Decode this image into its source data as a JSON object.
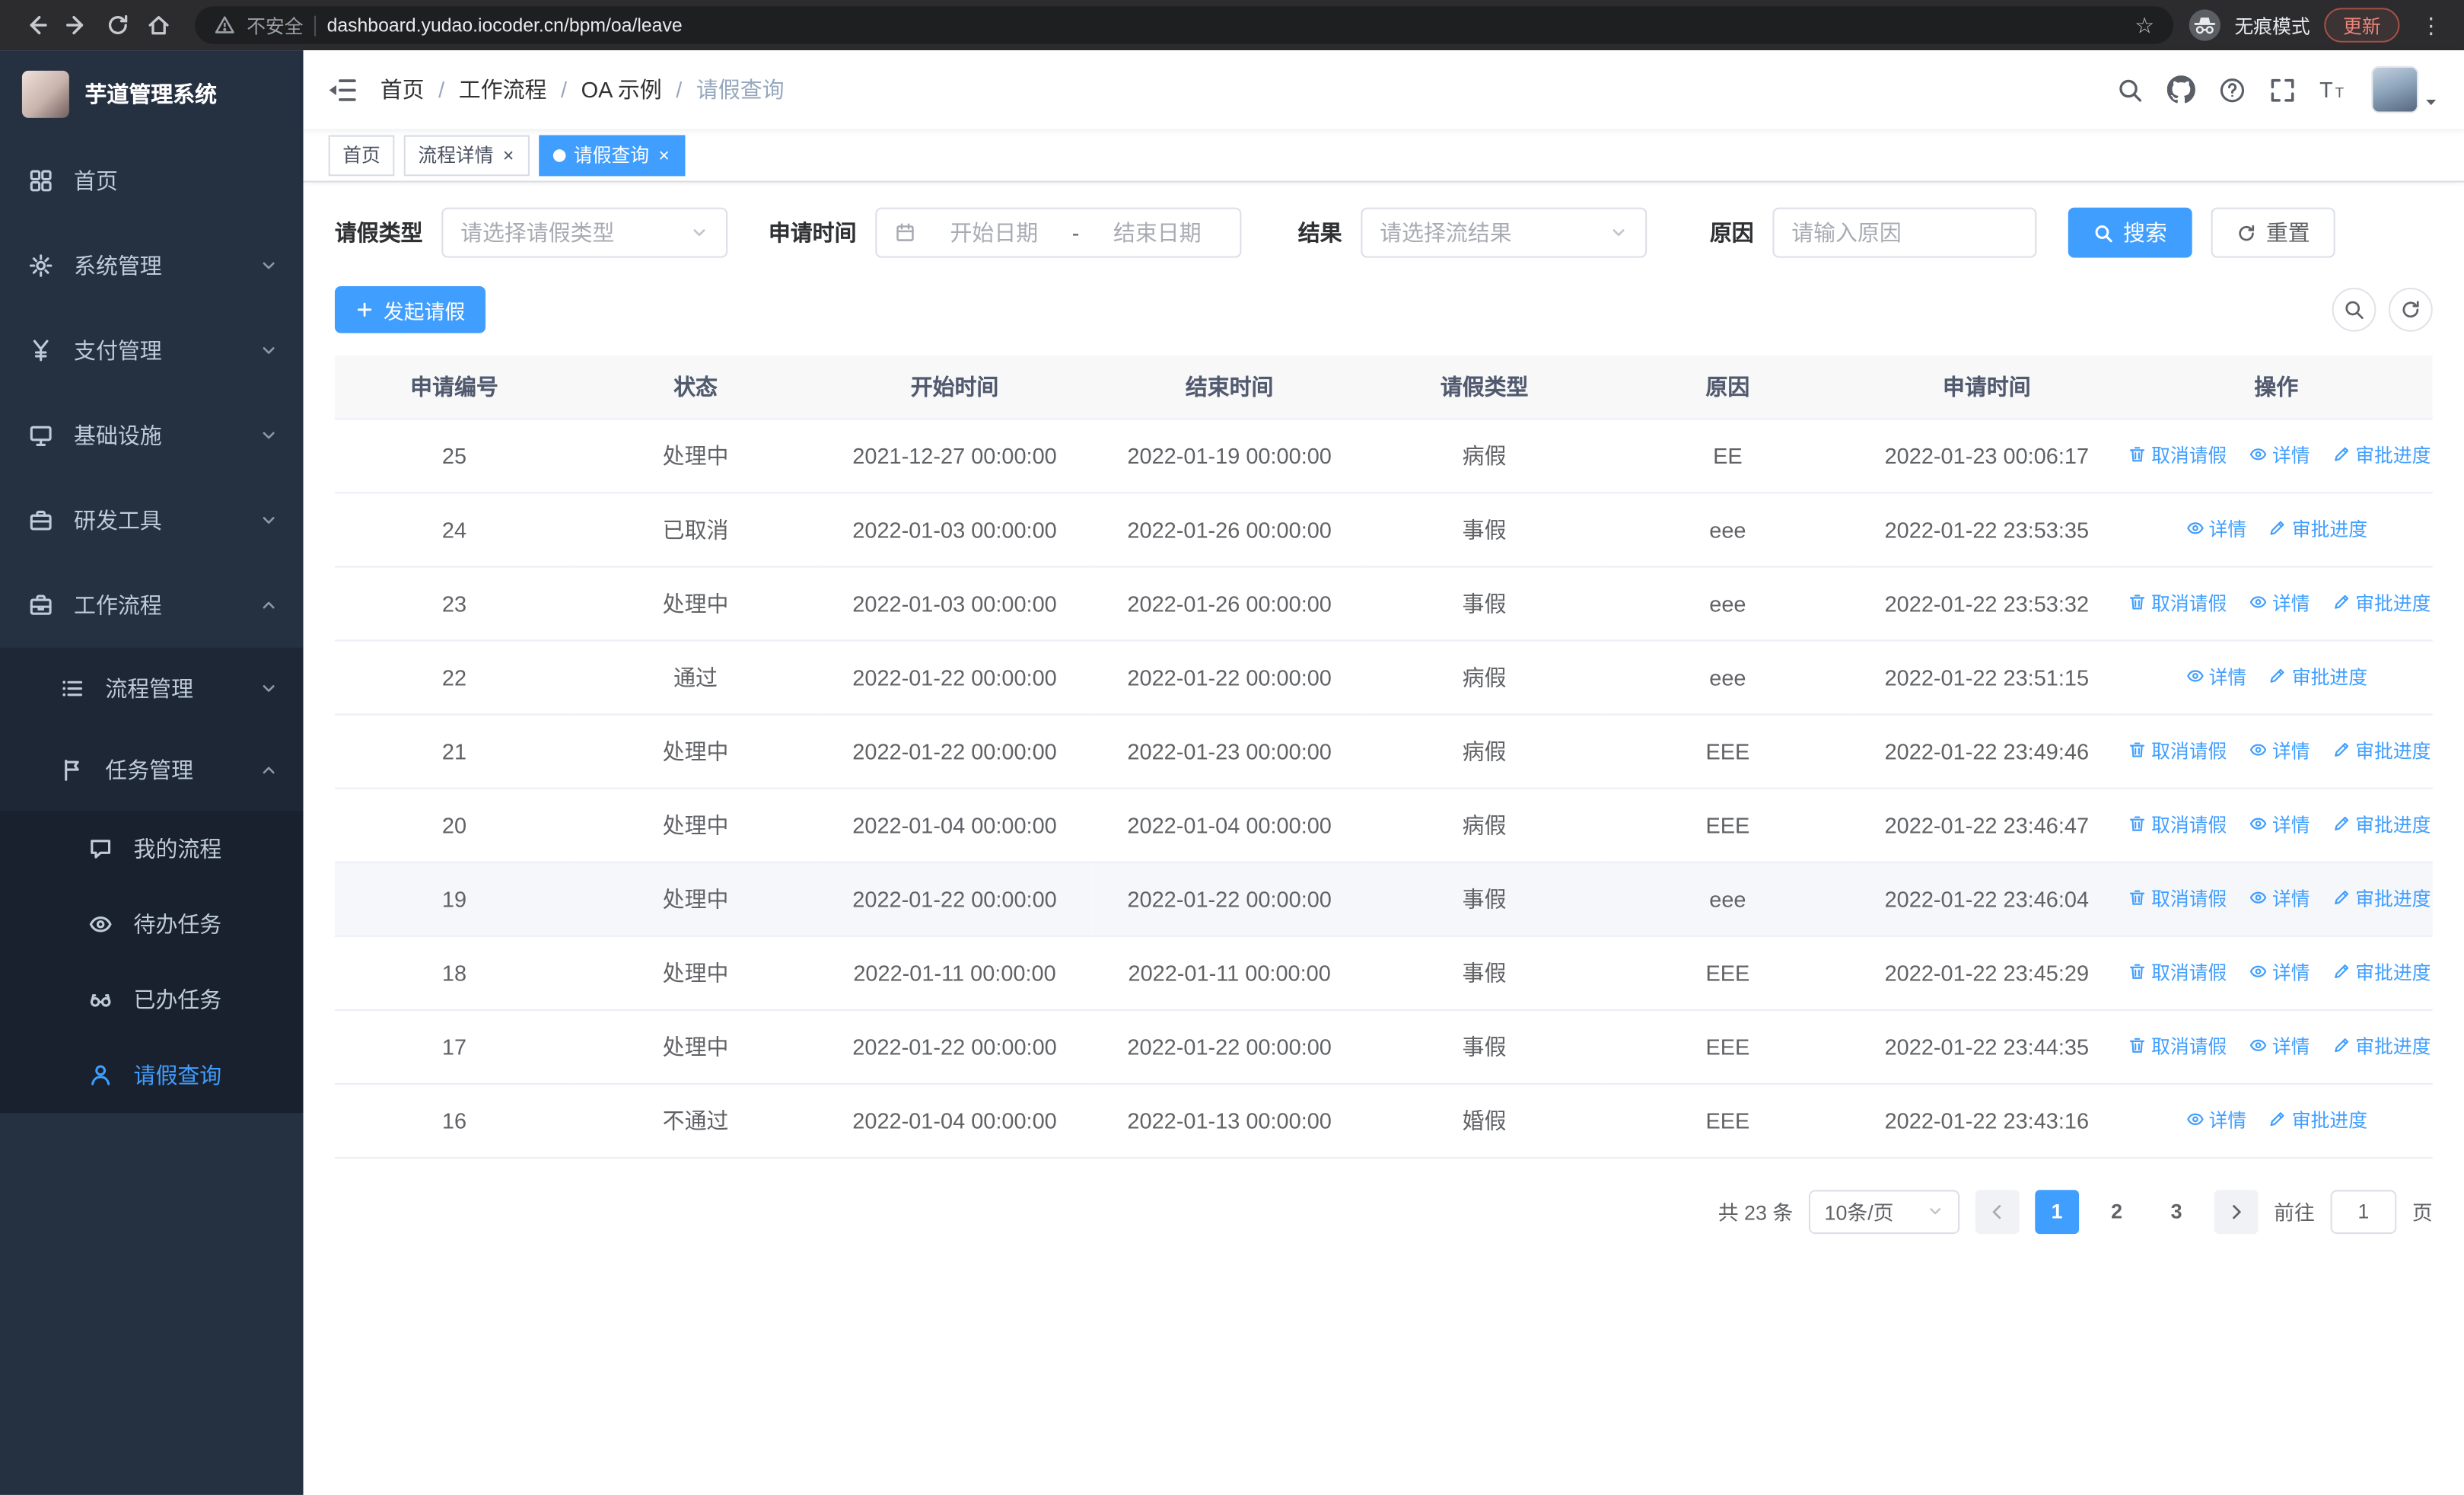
{
  "icons": {
    "close": "×",
    "dots_vertical": "⋮",
    "star": "☆"
  },
  "browser": {
    "security_label": "不安全",
    "url": "dashboard.yudao.iocoder.cn/bpm/oa/leave",
    "incognito_label": "无痕模式",
    "update_label": "更新"
  },
  "sidebar": {
    "logo_title": "芋道管理系统",
    "items": [
      {
        "label": "首页"
      },
      {
        "label": "系统管理"
      },
      {
        "label": "支付管理"
      },
      {
        "label": "基础设施"
      },
      {
        "label": "研发工具"
      },
      {
        "label": "工作流程"
      }
    ],
    "workflow_children": [
      {
        "label": "流程管理"
      },
      {
        "label": "任务管理"
      }
    ],
    "task_children": [
      {
        "label": "我的流程"
      },
      {
        "label": "待办任务"
      },
      {
        "label": "已办任务"
      },
      {
        "label": "请假查询"
      }
    ]
  },
  "navbar": {
    "breadcrumb": [
      "首页",
      "工作流程",
      "OA 示例",
      "请假查询"
    ],
    "separator": "/"
  },
  "tags": [
    {
      "label": "首页"
    },
    {
      "label": "流程详情"
    },
    {
      "label": "请假查询"
    }
  ],
  "filters": {
    "leave_type_label": "请假类型",
    "leave_type_placeholder": "请选择请假类型",
    "apply_time_label": "申请时间",
    "start_date_placeholder": "开始日期",
    "range_separator": "-",
    "end_date_placeholder": "结束日期",
    "result_label": "结果",
    "result_placeholder": "请选择流结果",
    "reason_label": "原因",
    "reason_placeholder": "请输入原因",
    "search_button": "搜索",
    "reset_button": "重置"
  },
  "toolbar": {
    "create_button": "发起请假"
  },
  "table": {
    "columns": [
      "申请编号",
      "状态",
      "开始时间",
      "结束时间",
      "请假类型",
      "原因",
      "申请时间",
      "操作"
    ],
    "actions": {
      "cancel": "取消请假",
      "detail": "详情",
      "progress": "审批进度"
    },
    "rows": [
      {
        "id": "25",
        "status": "处理中",
        "start": "2021-12-27 00:00:00",
        "end": "2022-01-19 00:00:00",
        "type": "病假",
        "reason": "EE",
        "apply_time": "2022-01-23 00:06:17",
        "cancelable": true
      },
      {
        "id": "24",
        "status": "已取消",
        "start": "2022-01-03 00:00:00",
        "end": "2022-01-26 00:00:00",
        "type": "事假",
        "reason": "eee",
        "apply_time": "2022-01-22 23:53:35",
        "cancelable": false
      },
      {
        "id": "23",
        "status": "处理中",
        "start": "2022-01-03 00:00:00",
        "end": "2022-01-26 00:00:00",
        "type": "事假",
        "reason": "eee",
        "apply_time": "2022-01-22 23:53:32",
        "cancelable": true
      },
      {
        "id": "22",
        "status": "通过",
        "start": "2022-01-22 00:00:00",
        "end": "2022-01-22 00:00:00",
        "type": "病假",
        "reason": "eee",
        "apply_time": "2022-01-22 23:51:15",
        "cancelable": false
      },
      {
        "id": "21",
        "status": "处理中",
        "start": "2022-01-22 00:00:00",
        "end": "2022-01-23 00:00:00",
        "type": "病假",
        "reason": "EEE",
        "apply_time": "2022-01-22 23:49:46",
        "cancelable": true
      },
      {
        "id": "20",
        "status": "处理中",
        "start": "2022-01-04 00:00:00",
        "end": "2022-01-04 00:00:00",
        "type": "病假",
        "reason": "EEE",
        "apply_time": "2022-01-22 23:46:47",
        "cancelable": true
      },
      {
        "id": "19",
        "status": "处理中",
        "start": "2022-01-22 00:00:00",
        "end": "2022-01-22 00:00:00",
        "type": "事假",
        "reason": "eee",
        "apply_time": "2022-01-22 23:46:04",
        "cancelable": true,
        "highlighted": true
      },
      {
        "id": "18",
        "status": "处理中",
        "start": "2022-01-11 00:00:00",
        "end": "2022-01-11 00:00:00",
        "type": "事假",
        "reason": "EEE",
        "apply_time": "2022-01-22 23:45:29",
        "cancelable": true
      },
      {
        "id": "17",
        "status": "处理中",
        "start": "2022-01-22 00:00:00",
        "end": "2022-01-22 00:00:00",
        "type": "事假",
        "reason": "EEE",
        "apply_time": "2022-01-22 23:44:35",
        "cancelable": true
      },
      {
        "id": "16",
        "status": "不通过",
        "start": "2022-01-04 00:00:00",
        "end": "2022-01-13 00:00:00",
        "type": "婚假",
        "reason": "EEE",
        "apply_time": "2022-01-22 23:43:16",
        "cancelable": false
      }
    ]
  },
  "pagination": {
    "total": "共 23 条",
    "page_size": "10条/页",
    "pages": [
      "1",
      "2",
      "3"
    ],
    "goto_label": "前往",
    "goto_value": "1",
    "unit_label": "页"
  }
}
